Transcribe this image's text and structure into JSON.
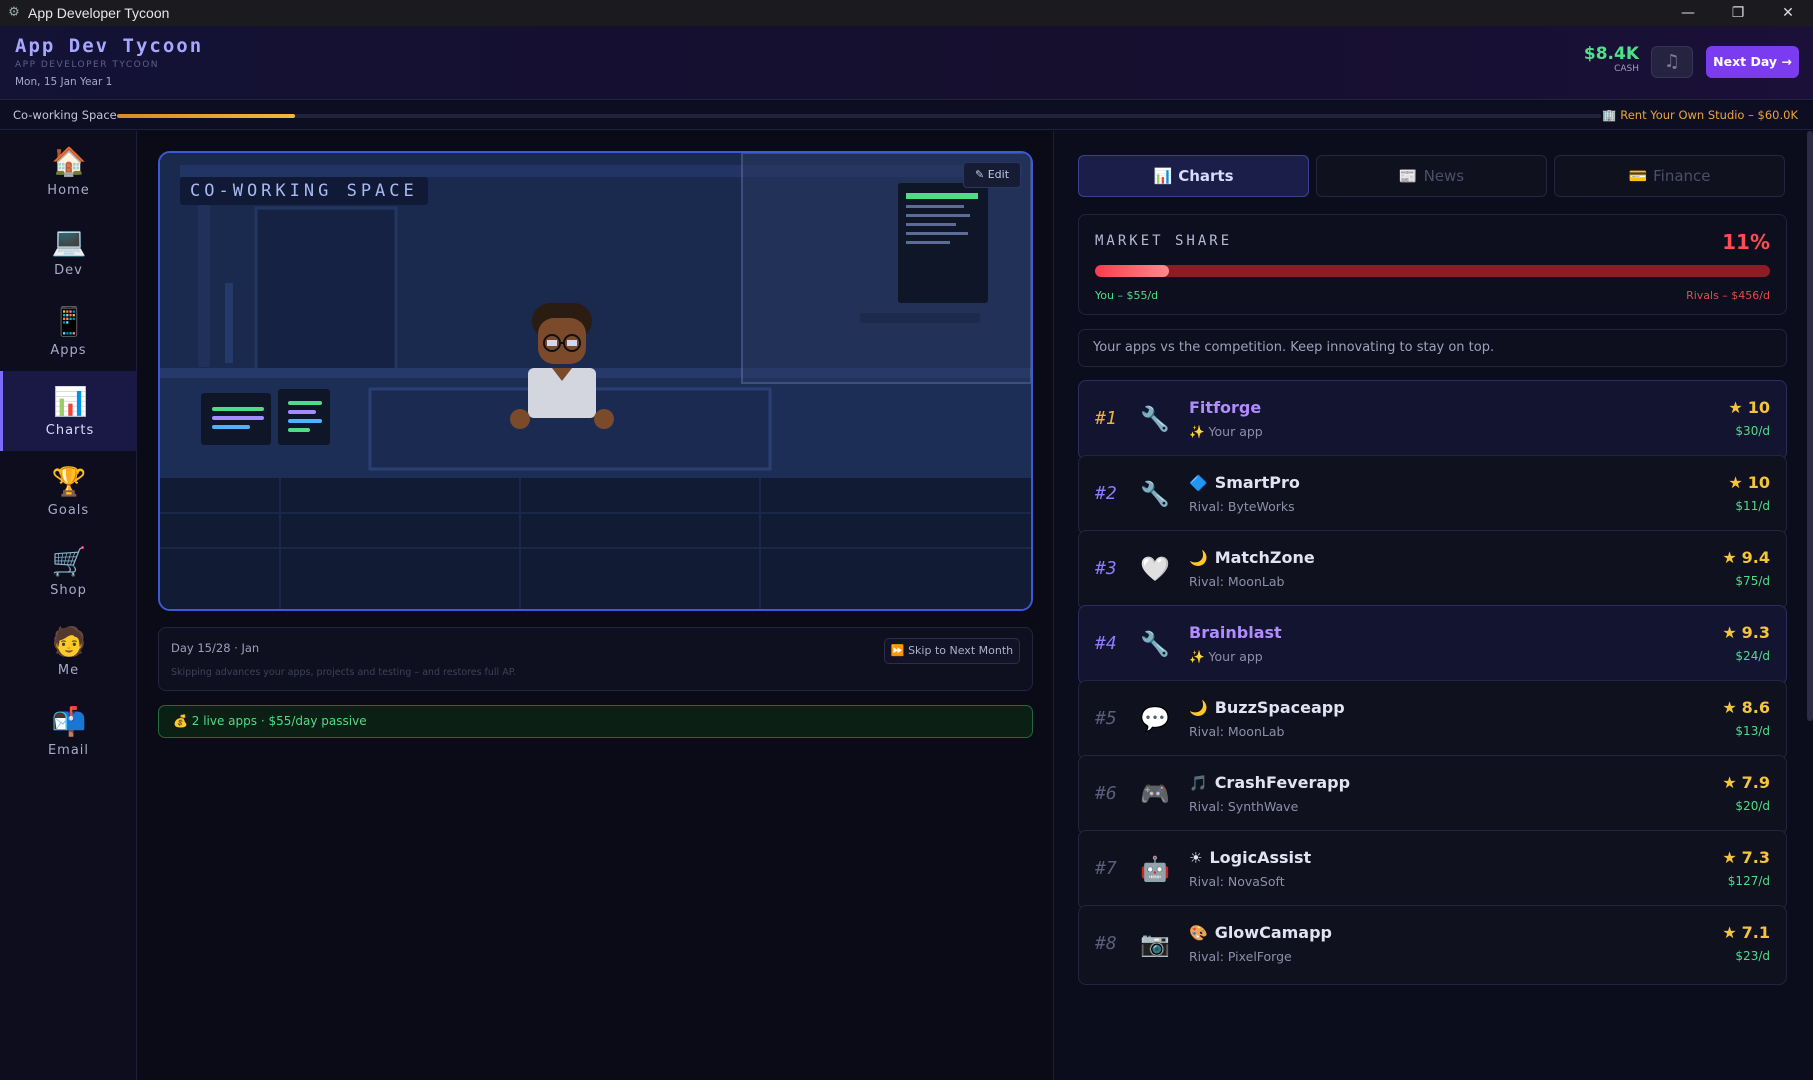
{
  "window": {
    "title": "App Developer Tycoon"
  },
  "header": {
    "brand": "App Dev Tycoon",
    "brand_sub": "APP DEVELOPER TYCOON",
    "date": "Mon, 15 Jan Year 1",
    "cash_value": "$8.4K",
    "cash_label": "CASH",
    "next_day": "Next Day →"
  },
  "office": {
    "label": "Co-working Space",
    "progress": 0.12,
    "goal": "Rent Your Own Studio – $60.0K"
  },
  "sidebar": {
    "items": [
      {
        "label": "Home",
        "icon": "house-icon"
      },
      {
        "label": "Dev",
        "icon": "laptop-icon"
      },
      {
        "label": "Apps",
        "icon": "phone-icon"
      },
      {
        "label": "Charts",
        "icon": "chart-icon"
      },
      {
        "label": "Goals",
        "icon": "trophy-icon"
      },
      {
        "label": "Shop",
        "icon": "cart-icon"
      },
      {
        "label": "Me",
        "icon": "person-icon"
      },
      {
        "label": "Email",
        "icon": "mailbox-icon"
      }
    ],
    "active": "Charts"
  },
  "scene": {
    "label": "CO-WORKING SPACE",
    "edit": "Edit"
  },
  "day": {
    "title": "Day 15/28 · Jan",
    "subtitle": "Skipping advances your apps, projects and testing – and restores full AP.",
    "skip": "Skip to Next Month"
  },
  "passive": "2 live apps · $55/day passive",
  "tabs": [
    {
      "label": "Charts",
      "icon": "chart-icon",
      "active": true
    },
    {
      "label": "News",
      "icon": "newspaper-icon",
      "active": false
    },
    {
      "label": "Finance",
      "icon": "card-icon",
      "active": false
    }
  ],
  "market_share": {
    "title": "MARKET SHARE",
    "percent": "11%",
    "share": 0.11,
    "you": "You – $55/d",
    "rivals": "Rivals – $456/d"
  },
  "tagline": "Your apps vs the competition. Keep innovating to stay on top.",
  "rankings": [
    {
      "rank": "#1",
      "category_icon": "wrench-icon",
      "name_icon": "",
      "name": "Fitforge",
      "owner": "✨ Your app",
      "mine": true,
      "score": "10",
      "income": "$30/d"
    },
    {
      "rank": "#2",
      "category_icon": "wrench-icon",
      "name_icon": "diamond-icon",
      "name": "SmartPro",
      "owner": "Rival: ByteWorks",
      "mine": false,
      "score": "10",
      "income": "$11/d"
    },
    {
      "rank": "#3",
      "category_icon": "heart-icon",
      "name_icon": "moon-icon",
      "name": "MatchZone",
      "owner": "Rival: MoonLab",
      "mine": false,
      "score": "9.4",
      "income": "$75/d"
    },
    {
      "rank": "#4",
      "category_icon": "wrench-icon",
      "name_icon": "",
      "name": "Brainblast",
      "owner": "✨ Your app",
      "mine": true,
      "score": "9.3",
      "income": "$24/d"
    },
    {
      "rank": "#5",
      "category_icon": "speech-icon",
      "name_icon": "moon-icon",
      "name": "BuzzSpaceapp",
      "owner": "Rival: MoonLab",
      "mine": false,
      "score": "8.6",
      "income": "$13/d"
    },
    {
      "rank": "#6",
      "category_icon": "gamepad-icon",
      "name_icon": "music-icon",
      "name": "CrashFeverapp",
      "owner": "Rival: SynthWave",
      "mine": false,
      "score": "7.9",
      "income": "$20/d"
    },
    {
      "rank": "#7",
      "category_icon": "robot-icon",
      "name_icon": "sun-icon",
      "name": "LogicAssist",
      "owner": "Rival: NovaSoft",
      "mine": false,
      "score": "7.3",
      "income": "$127/d"
    },
    {
      "rank": "#8",
      "category_icon": "camera-icon",
      "name_icon": "palette-icon",
      "name": "GlowCamapp",
      "owner": "Rival: PixelForge",
      "mine": false,
      "score": "7.1",
      "income": "$23/d"
    }
  ]
}
